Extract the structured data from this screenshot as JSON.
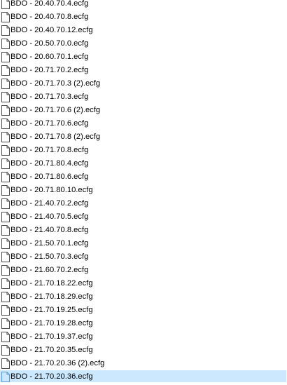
{
  "file_list": {
    "items": [
      {
        "name": "BDO - 20.40.70.4.ecfg",
        "selected": false
      },
      {
        "name": "BDO - 20.40.70.8.ecfg",
        "selected": false
      },
      {
        "name": "BDO - 20.40.70.12.ecfg",
        "selected": false
      },
      {
        "name": "BDO - 20.50.70.0.ecfg",
        "selected": false
      },
      {
        "name": "BDO - 20.60.70.1.ecfg",
        "selected": false
      },
      {
        "name": "BDO - 20.71.70.2.ecfg",
        "selected": false
      },
      {
        "name": "BDO - 20.71.70.3 (2).ecfg",
        "selected": false
      },
      {
        "name": "BDO - 20.71.70.3.ecfg",
        "selected": false
      },
      {
        "name": "BDO - 20.71.70.6 (2).ecfg",
        "selected": false
      },
      {
        "name": "BDO - 20.71.70.6.ecfg",
        "selected": false
      },
      {
        "name": "BDO - 20.71.70.8 (2).ecfg",
        "selected": false
      },
      {
        "name": "BDO - 20.71.70.8.ecfg",
        "selected": false
      },
      {
        "name": "BDO - 20.71.80.4.ecfg",
        "selected": false
      },
      {
        "name": "BDO - 20.71.80.6.ecfg",
        "selected": false
      },
      {
        "name": "BDO - 20.71.80.10.ecfg",
        "selected": false
      },
      {
        "name": "BDO - 21.40.70.2.ecfg",
        "selected": false
      },
      {
        "name": "BDO - 21.40.70.5.ecfg",
        "selected": false
      },
      {
        "name": "BDO - 21.40.70.8.ecfg",
        "selected": false
      },
      {
        "name": "BDO - 21.50.70.1.ecfg",
        "selected": false
      },
      {
        "name": "BDO - 21.50.70.3.ecfg",
        "selected": false
      },
      {
        "name": "BDO - 21.60.70.2.ecfg",
        "selected": false
      },
      {
        "name": "BDO - 21.70.18.22.ecfg",
        "selected": false
      },
      {
        "name": "BDO - 21.70.18.29.ecfg",
        "selected": false
      },
      {
        "name": "BDO - 21.70.19.25.ecfg",
        "selected": false
      },
      {
        "name": "BDO - 21.70.19.28.ecfg",
        "selected": false
      },
      {
        "name": "BDO - 21.70.19.37.ecfg",
        "selected": false
      },
      {
        "name": "BDO - 21.70.20.35.ecfg",
        "selected": false
      },
      {
        "name": "BDO - 21.70.20.36 (2).ecfg",
        "selected": false
      },
      {
        "name": "BDO - 21.70.20.36.ecfg",
        "selected": true
      }
    ],
    "icon": "file-icon",
    "colors": {
      "selection_background": "#cce8ff",
      "icon_outline": "#4d4d4d",
      "icon_outline_selected": "#5b9bd5",
      "icon_fill": "#ffffff",
      "icon_fill_selected": "#cce8ff"
    }
  }
}
